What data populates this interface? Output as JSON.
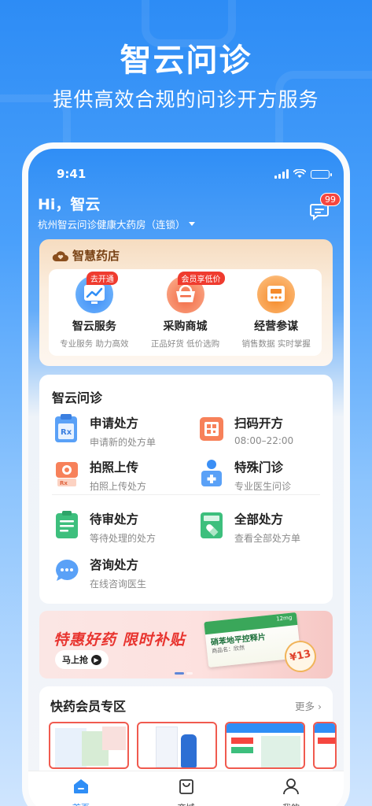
{
  "hero": {
    "title": "智云问诊",
    "subtitle": "提供高效合规的问诊开方服务"
  },
  "status_bar": {
    "time": "9:41"
  },
  "header": {
    "greeting": "Hi，智云",
    "store_name": "杭州智云问诊健康大药房（连锁）",
    "message_badge": "99"
  },
  "smart_store": {
    "title": "智慧药店",
    "items": [
      {
        "name": "智云服务",
        "desc": "专业服务 助力高效",
        "tag": "去开通"
      },
      {
        "name": "采购商城",
        "desc": "正品好货 低价选购",
        "tag": "会员享低价"
      },
      {
        "name": "经营参谋",
        "desc": "销售数据 实时掌握",
        "tag": ""
      }
    ]
  },
  "zhiyun": {
    "title": "智云问诊",
    "services": [
      {
        "name": "申请处方",
        "desc": "申请新的处方单"
      },
      {
        "name": "扫码开方",
        "desc": "08:00–22:00"
      },
      {
        "name": "拍照上传",
        "desc": "拍照上传处方"
      },
      {
        "name": "特殊门诊",
        "desc": "专业医生问诊"
      },
      {
        "name": "待审处方",
        "desc": "等待处理的处方"
      },
      {
        "name": "全部处方",
        "desc": "查看全部处方单"
      },
      {
        "name": "咨询处方",
        "desc": "在线咨询医生"
      }
    ]
  },
  "banner": {
    "title": "特惠好药 限时补贴",
    "button": "马上抢",
    "product_name": "硝苯地平控释片",
    "product_detail": "商品名：欣然",
    "spec": "12mg",
    "price": "¥13"
  },
  "member": {
    "title": "快药会员专区",
    "more": "更多"
  },
  "tabbar": {
    "items": [
      {
        "label": "首页"
      },
      {
        "label": "商城"
      },
      {
        "label": "我的"
      }
    ]
  },
  "colors": {
    "primary": "#2f8ef6",
    "accent_red": "#f5463f",
    "gold": "#7a4417"
  }
}
